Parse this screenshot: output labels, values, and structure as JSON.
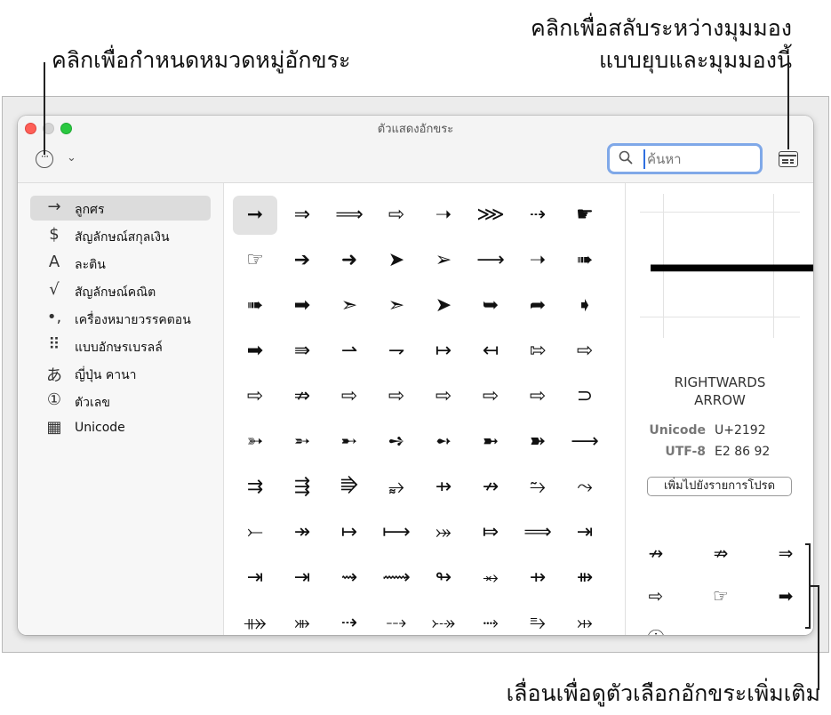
{
  "callouts": {
    "category": "คลิกเพื่อกำหนดหมวดหมู่อักขระ",
    "toggle_line1": "คลิกเพื่อสลับระหว่างมุมมอง",
    "toggle_line2": "แบบยุบและมุมมองนี้",
    "scroll": "เลื่อนเพื่อดูตัวเลือกอักขระเพิ่มเติม"
  },
  "window": {
    "title": "ตัวแสดงอักขระ",
    "more_glyph": "···",
    "chevron_glyph": "⌄"
  },
  "search": {
    "placeholder": "ค้นหา"
  },
  "sidebar": {
    "items": [
      {
        "icon": "→",
        "label": "ลูกศร",
        "selected": true
      },
      {
        "icon": "$",
        "label": "สัญลักษณ์สกุลเงิน"
      },
      {
        "icon": "A",
        "label": "ละติน"
      },
      {
        "icon": "√",
        "label": "สัญลักษณ์คณิต"
      },
      {
        "icon": "•,",
        "label": "เครื่องหมายวรรคตอน"
      },
      {
        "icon": "⠿",
        "label": "แบบอักษรเบรลล์"
      },
      {
        "icon": "あ",
        "label": "ญี่ปุ่น คานา"
      },
      {
        "icon": "①",
        "label": "ตัวเลข"
      },
      {
        "icon": "▦",
        "label": "Unicode"
      }
    ]
  },
  "grid": {
    "rows": [
      [
        "➞",
        "⇒",
        "⟹",
        "⇨",
        "➝",
        "⋙",
        "⇢",
        "☛"
      ],
      [
        "☞",
        "➔",
        "➜",
        "➤",
        "➢",
        "⟶",
        "➝",
        "➠"
      ],
      [
        "➠",
        "➡",
        "➣",
        "➣",
        "➤",
        "➥",
        "➦",
        "➧"
      ],
      [
        "➡",
        "⇛",
        "⇀",
        "⇁",
        "↦",
        "↤",
        "⇰",
        "⇨"
      ],
      [
        "⇨",
        "⇏",
        "⇨",
        "⇨",
        "⇨",
        "⇨",
        "⇨",
        "⊃"
      ],
      [
        "➳",
        "➵",
        "➸",
        "➺",
        "➻",
        "➼",
        "➽",
        "⟶"
      ],
      [
        "⇉",
        "⇶",
        "⭆",
        "⥵",
        "⇸",
        "↛",
        "⥲",
        "⤳"
      ],
      [
        "⤚",
        "↠",
        "↦",
        "⟼",
        "⤖",
        "⤇",
        "⟹",
        "⇥"
      ],
      [
        "⇥",
        "⇥",
        "⇝",
        "⟿",
        "↬",
        "⥇",
        "⇸",
        "⇻"
      ],
      [
        "⤁",
        "⤕",
        "⇢",
        "⤏",
        "⤐",
        "⤑",
        "⥱",
        "⤔"
      ]
    ]
  },
  "detail": {
    "glyph": "🡒",
    "name_line1": "RIGHTWARDS",
    "name_line2": "ARROW",
    "unicode_label": "Unicode",
    "unicode_value": "U+2192",
    "utf8_label": "UTF-8",
    "utf8_value": "E2 86 92",
    "favorite_button": "เพิ่มไปยังรายการโปรด",
    "variants": [
      "↛",
      "⇏",
      "⇒",
      "⇨",
      "☞",
      "➡",
      "ⓘ",
      "⥄"
    ]
  }
}
